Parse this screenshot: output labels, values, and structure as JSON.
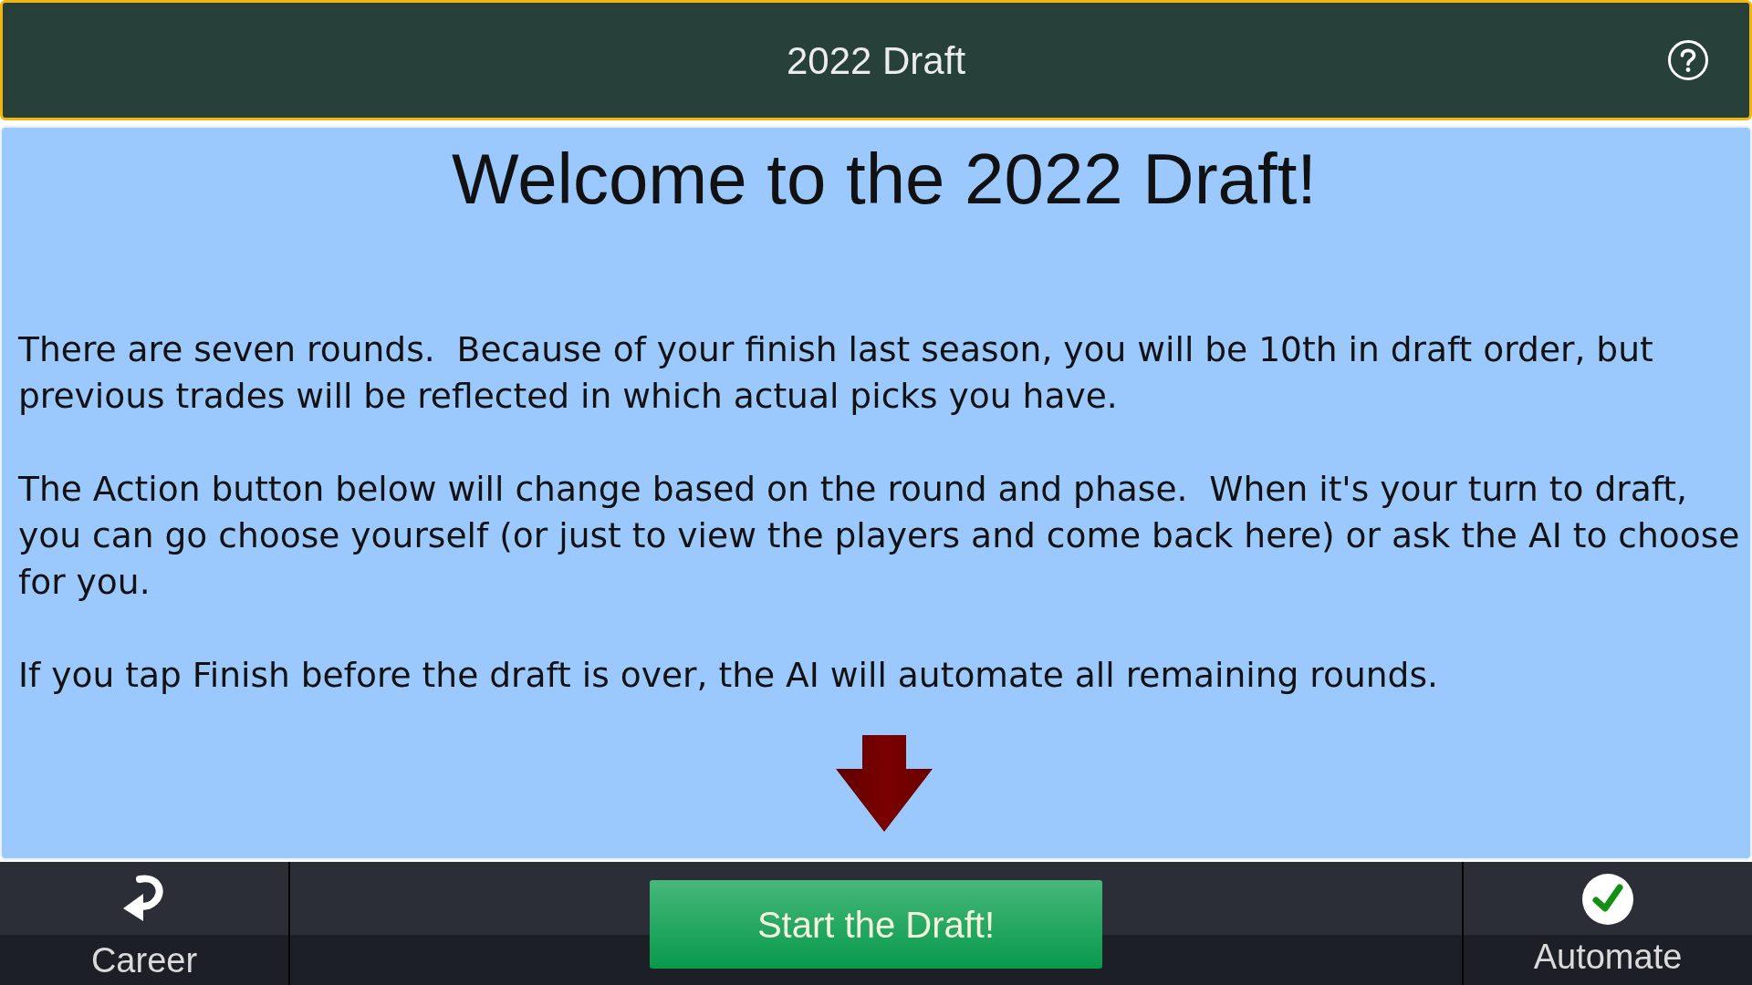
{
  "header": {
    "title": "2022 Draft"
  },
  "panel": {
    "heading": "Welcome to the 2022 Draft!",
    "paragraphs": [
      "There are seven rounds.  Because of your finish last season, you will be 10th in draft order, but previous trades will be reflected in which actual picks you have.",
      "The Action button below will change based on the round and phase.  When it's your turn to draft, you can go choose yourself (or just to view the players and come back here) or ask the AI to choose for you.",
      "If you tap Finish before the draft is over, the AI will automate all remaining rounds."
    ]
  },
  "bottom_bar": {
    "left_button": {
      "label": "Career"
    },
    "action_button": {
      "label": "Start the Draft!"
    },
    "right_button": {
      "label": "Automate"
    }
  }
}
